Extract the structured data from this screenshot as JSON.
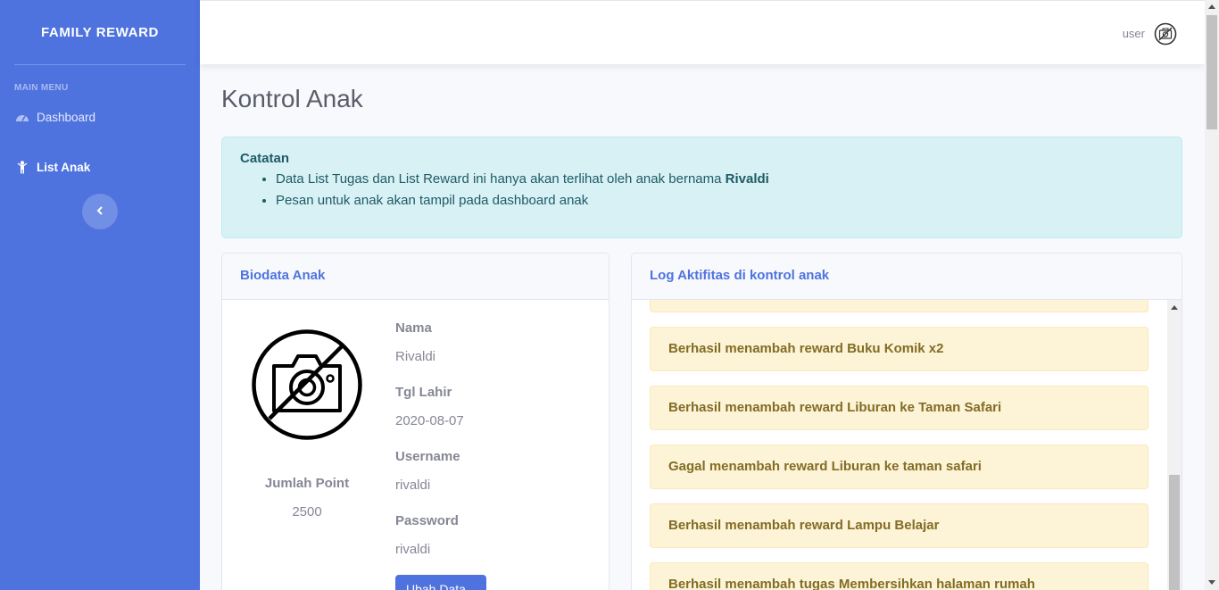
{
  "brand": "FAMILY REWARD",
  "sidebar": {
    "heading": "MAIN MENU",
    "items": [
      {
        "label": "Dashboard",
        "icon": "tachometer-icon"
      },
      {
        "label": "List Anak",
        "icon": "child-icon"
      }
    ],
    "toggle_icon": "chevron-left-icon"
  },
  "topbar": {
    "user": "user",
    "avatar_icon": "no-photo-icon"
  },
  "page_title": "Kontrol Anak",
  "note": {
    "title": "Catatan",
    "line1_prefix": "Data List Tugas dan List Reward ini hanya akan terlihat oleh anak bernama",
    "child_name": "Rivaldi",
    "line2": "Pesan untuk anak akan tampil pada dashboard anak"
  },
  "biodata": {
    "title": "Biodata Anak",
    "photo_icon": "no-photo-icon",
    "points_label": "Jumlah Point",
    "points_value": "2500",
    "fields": [
      {
        "label": "Nama",
        "value": "Rivaldi"
      },
      {
        "label": "Tgl Lahir",
        "value": "2020-08-07"
      },
      {
        "label": "Username",
        "value": "rivaldi"
      },
      {
        "label": "Password",
        "value": "rivaldi"
      }
    ],
    "edit_button": "Ubah Data"
  },
  "log": {
    "title": "Log Aktifitas di kontrol anak",
    "items": [
      "",
      "Berhasil menambah reward Buku Komik x2",
      "Berhasil menambah reward Liburan ke Taman Safari",
      "Gagal menambah reward Liburan ke taman safari",
      "Berhasil menambah reward Lampu Belajar",
      "Berhasil menambah tugas Membersihkan halaman rumah"
    ]
  },
  "colors": {
    "primary": "#4e73df",
    "info_bg": "#d7f1f5",
    "warning_bg": "#fdf3d7",
    "warning_text": "#826d25"
  }
}
